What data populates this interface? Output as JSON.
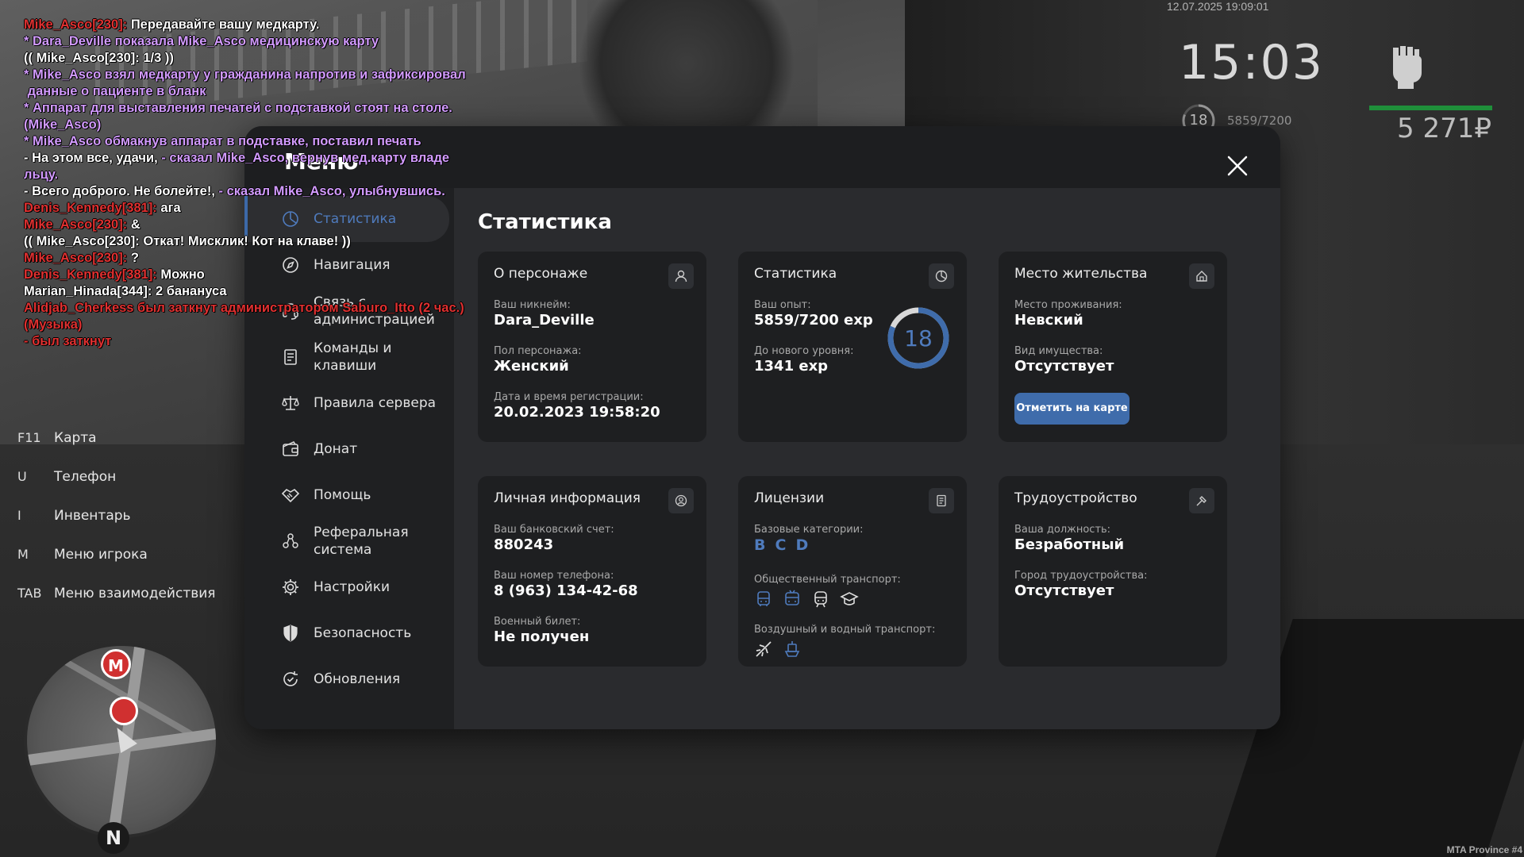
{
  "chat": [
    {
      "parts": [
        {
          "c": "red",
          "t": "Mike_Asco[230]: "
        },
        {
          "c": "white",
          "t": "Передавайте вашу медкарту."
        }
      ]
    },
    {
      "parts": [
        {
          "c": "purple",
          "t": "* Dara_Deville показала Mike_Asco медицинскую карту"
        }
      ]
    },
    {
      "parts": [
        {
          "c": "white",
          "t": "(( Mike_Asco[230]: 1/3 ))"
        }
      ]
    },
    {
      "parts": [
        {
          "c": "purple",
          "t": "* Mike_Asco взял медкарту у гражданина напротив и зафиксировал"
        }
      ]
    },
    {
      "parts": [
        {
          "c": "purple",
          "t": " данные о пациенте в бланк"
        }
      ]
    },
    {
      "parts": [
        {
          "c": "purple",
          "t": "* Аппарат для выставления печатей с подставкой стоят на столе."
        }
      ]
    },
    {
      "parts": [
        {
          "c": "purple",
          "t": "(Mike_Asco)"
        }
      ]
    },
    {
      "parts": [
        {
          "c": "purple",
          "t": "* Mike_Asco обмакнув аппарат в подставке, поставил печать"
        }
      ]
    },
    {
      "parts": [
        {
          "c": "white",
          "t": "- На этом все, удачи, "
        },
        {
          "c": "purple",
          "t": "- сказал Mike_Asco, вернув мед.карту владе"
        }
      ]
    },
    {
      "parts": [
        {
          "c": "purple",
          "t": "льцу."
        }
      ]
    },
    {
      "parts": [
        {
          "c": "white",
          "t": "- Всего доброго. Не болейте!, "
        },
        {
          "c": "purple",
          "t": "- сказал Mike_Asco, улыбнувшись."
        }
      ]
    },
    {
      "parts": [
        {
          "c": "red",
          "t": "Denis_Kennedy[381]: "
        },
        {
          "c": "white",
          "t": "ага"
        }
      ]
    },
    {
      "parts": [
        {
          "c": "red",
          "t": "Mike_Asco[230]: "
        },
        {
          "c": "white",
          "t": "&"
        }
      ]
    },
    {
      "parts": [
        {
          "c": "white",
          "t": "(( Mike_Asco[230]: Откат! Мисклик! Кот на клаве! ))"
        }
      ]
    },
    {
      "parts": [
        {
          "c": "red",
          "t": "Mike_Asco[230]: "
        },
        {
          "c": "white",
          "t": "?"
        }
      ]
    },
    {
      "parts": [
        {
          "c": "red",
          "t": "Denis_Kennedy[381]: "
        },
        {
          "c": "white",
          "t": "Можно"
        }
      ]
    },
    {
      "parts": [
        {
          "c": "white",
          "t": "Marian_Hinada[344]: 2 банануса"
        }
      ]
    },
    {
      "parts": [
        {
          "c": "red",
          "t": "Alidjab_Cherkess был заткнут администратором Saburo_Itto (2 час.)"
        }
      ]
    },
    {
      "parts": [
        {
          "c": "red",
          "t": "(Музыка)"
        }
      ]
    },
    {
      "parts": [
        {
          "c": "red",
          "t": "- был заткнут"
        }
      ]
    }
  ],
  "hud": {
    "date": "12.07.2025 19:09:01",
    "time": "15:03",
    "level": "18",
    "exp": "5859/7200",
    "money": "5 271₽"
  },
  "hotkeys": [
    {
      "key": "F11",
      "label": "Карта"
    },
    {
      "key": "U",
      "label": "Телефон"
    },
    {
      "key": "I",
      "label": "Инвентарь"
    },
    {
      "key": "M",
      "label": "Меню игрока"
    },
    {
      "key": "TAB",
      "label": "Меню взаимодействия"
    }
  ],
  "minimap": {
    "north": "N",
    "marker": "M"
  },
  "menu": {
    "title": "Меню",
    "sidebar": [
      {
        "id": "stats",
        "label": "Статистика",
        "icon": "pie-chart-icon",
        "active": true
      },
      {
        "id": "nav",
        "label": "Навигация",
        "icon": "compass-icon"
      },
      {
        "id": "admin",
        "label": "Связь с администрацией",
        "icon": "headset-icon"
      },
      {
        "id": "cmds",
        "label": "Команды и клавиши",
        "icon": "document-icon"
      },
      {
        "id": "rules",
        "label": "Правила сервера",
        "icon": "scales-icon"
      },
      {
        "id": "donate",
        "label": "Донат",
        "icon": "wallet-icon"
      },
      {
        "id": "help",
        "label": "Помощь",
        "icon": "handshake-icon"
      },
      {
        "id": "ref",
        "label": "Реферальная система",
        "icon": "people-icon"
      },
      {
        "id": "settings",
        "label": "Настройки",
        "icon": "gear-icon"
      },
      {
        "id": "security",
        "label": "Безопасность",
        "icon": "shield-icon"
      },
      {
        "id": "updates",
        "label": "Обновления",
        "icon": "refresh-icon"
      }
    ],
    "content_title": "Статистика",
    "cards": {
      "character": {
        "title": "О персонаже",
        "nickname_label": "Ваш никнейм:",
        "nickname": "Dara_Deville",
        "gender_label": "Пол персонажа:",
        "gender": "Женский",
        "reg_label": "Дата и время регистрации:",
        "reg": "20.02.2023 19:58:20"
      },
      "stats": {
        "title": "Статистика",
        "exp_label": "Ваш опыт:",
        "exp": "5859/7200 exp",
        "next_label": "До нового уровня:",
        "next": "1341 exp",
        "level": "18",
        "progress": 0.81375
      },
      "residence": {
        "title": "Место жительства",
        "place_label": "Место проживания:",
        "place": "Невский",
        "property_label": "Вид имущества:",
        "property": "Отсутствует",
        "button": "Отметить на карте"
      },
      "personal": {
        "title": "Личная информация",
        "bank_label": "Ваш банковский счет:",
        "bank": "880243",
        "phone_label": "Ваш номер телефона:",
        "phone": "8 (963) 134-42-68",
        "military_label": "Военный билет:",
        "military": "Не получен"
      },
      "licenses": {
        "title": "Лицензии",
        "basic_label": "Базовые категории:",
        "categories": [
          "B",
          "C",
          "D"
        ],
        "public_label": "Общественный транспорт:",
        "air_label": "Воздушный и водный транспорт:"
      },
      "employment": {
        "title": "Трудоустройство",
        "position_label": "Ваша должность:",
        "position": "Безработный",
        "city_label": "Город трудоустройства:",
        "city": "Отсутствует"
      }
    }
  },
  "colors": {
    "accent": "#3f6cab",
    "accent_text": "#4f7bbd",
    "chat_red": "#e03030",
    "chat_purple": "#d39bff",
    "hud_bar": "#1f8f3a"
  },
  "footer": "MTA Province #4"
}
